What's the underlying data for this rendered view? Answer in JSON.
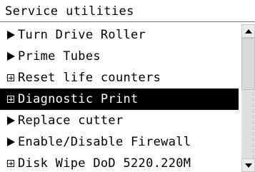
{
  "screen": {
    "title": "Service utilities"
  },
  "menu": {
    "items": [
      {
        "label": "Turn Drive Roller",
        "icon": "arrow-right-icon",
        "selected": false
      },
      {
        "label": "Prime Tubes",
        "icon": "arrow-right-icon",
        "selected": false
      },
      {
        "label": "Reset life counters",
        "icon": "expand-plus-icon",
        "selected": false
      },
      {
        "label": "Diagnostic Print",
        "icon": "expand-plus-icon",
        "selected": true
      },
      {
        "label": "Replace cutter",
        "icon": "arrow-right-icon",
        "selected": false
      },
      {
        "label": "Enable/Disable Firewall",
        "icon": "arrow-right-icon",
        "selected": false
      },
      {
        "label": "Disk Wipe DoD 5220.220M",
        "icon": "expand-plus-icon",
        "selected": false
      }
    ]
  },
  "colors": {
    "selected_bg": "#000000",
    "selected_fg": "#ffffff",
    "text": "#000000"
  }
}
